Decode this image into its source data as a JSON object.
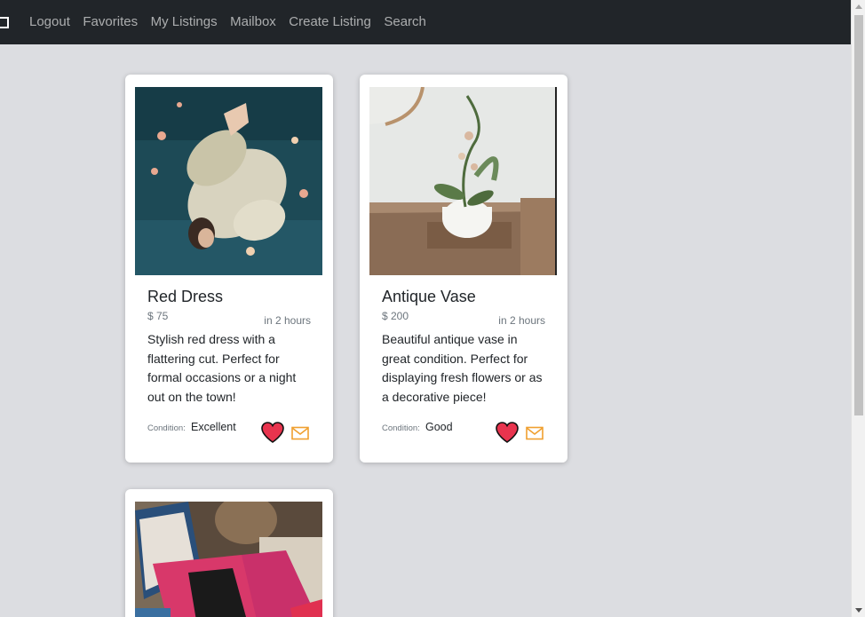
{
  "nav": {
    "links": [
      "Logout",
      "Favorites",
      "My Listings",
      "Mailbox",
      "Create Listing",
      "Search"
    ]
  },
  "listings": [
    {
      "title": "Red Dress",
      "price": "$ 75",
      "time": "in 2 hours",
      "description": "Stylish red dress with a flattering cut. Perfect for formal occasions or a night out on the town!",
      "condition_label": "Condition:",
      "condition": "Excellent"
    },
    {
      "title": "Antique Vase",
      "price": "$ 200",
      "time": "in 2 hours",
      "description": "Beautiful antique vase in great condition. Perfect for displaying fresh flowers or as a decorative piece!",
      "condition_label": "Condition:",
      "condition": "Good"
    }
  ],
  "colors": {
    "navbar": "#212529",
    "background": "#dcdde1",
    "heart": "#e8344e",
    "mail": "#f0a030"
  },
  "icons": {
    "favorite": "heart-icon",
    "message": "mail-icon"
  }
}
